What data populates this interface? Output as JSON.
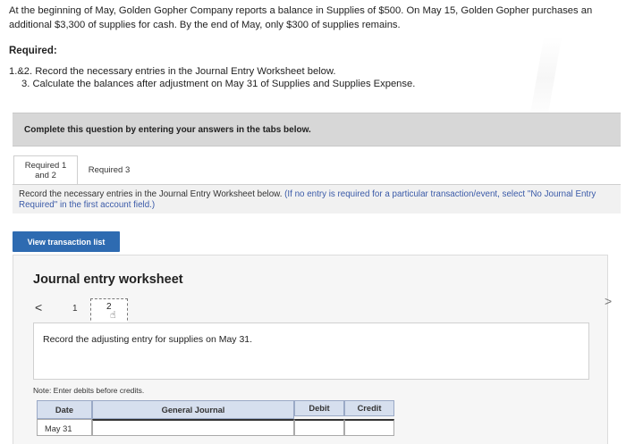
{
  "problem": {
    "text": "At the beginning of May, Golden Gopher Company reports a balance in Supplies of $500. On May 15, Golden Gopher purchases an additional $3,300 of supplies for cash. By the end of May, only $300 of supplies remains."
  },
  "required": {
    "heading": "Required:",
    "line1": "1.&2. Record the necessary entries in the Journal Entry Worksheet below.",
    "line2": "3. Calculate the balances after adjustment on May 31 of Supplies and Supplies Expense."
  },
  "banner": {
    "text": "Complete this question by entering your answers in the tabs below."
  },
  "tabs": [
    {
      "label_line1": "Required 1",
      "label_line2": "and 2"
    },
    {
      "label": "Required 3"
    }
  ],
  "instructions": {
    "main": "Record the necessary entries in the Journal Entry Worksheet below.",
    "hint": "(If no entry is required for a particular transaction/event, select \"No Journal Entry Required\" in the first account field.)"
  },
  "view_button": {
    "label": "View transaction list"
  },
  "worksheet": {
    "title": "Journal entry worksheet",
    "nav": {
      "prev": "<",
      "page1": "1",
      "page2": "2",
      "next": ">"
    },
    "entry_prompt": "Record the adjusting entry for supplies on May 31.",
    "note": "Note: Enter debits before credits.",
    "table": {
      "headers": {
        "date": "Date",
        "general_journal": "General Journal",
        "debit": "Debit",
        "credit": "Credit"
      },
      "rows": [
        {
          "date": "May 31",
          "account": "",
          "debit": "",
          "credit": ""
        }
      ]
    }
  }
}
